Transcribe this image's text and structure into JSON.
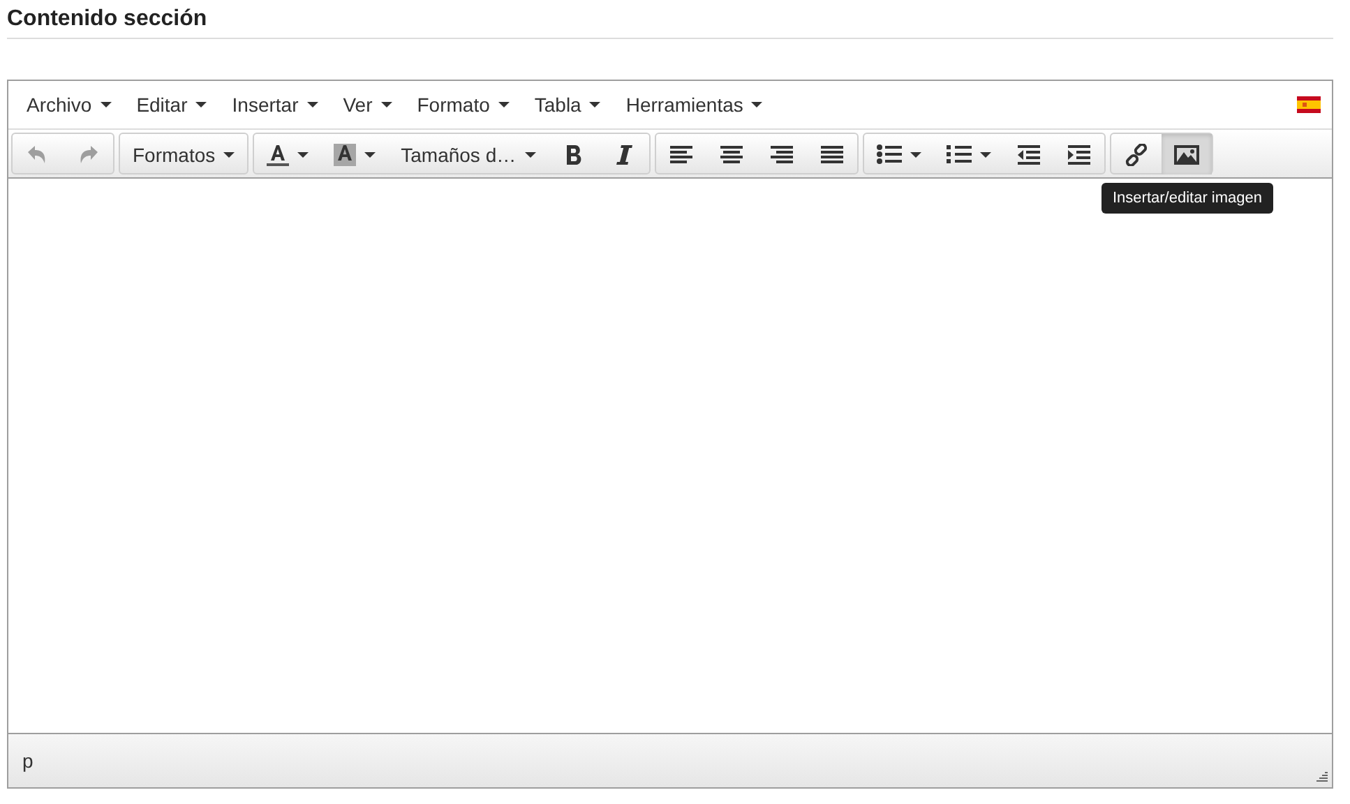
{
  "heading": "Contenido sección",
  "menu": [
    {
      "label": "Archivo"
    },
    {
      "label": "Editar"
    },
    {
      "label": "Insertar"
    },
    {
      "label": "Ver"
    },
    {
      "label": "Formato"
    },
    {
      "label": "Tabla"
    },
    {
      "label": "Herramientas"
    }
  ],
  "toolbar": [
    [
      {
        "kind": "undo",
        "disabled": true,
        "active": false
      },
      {
        "kind": "redo",
        "disabled": true,
        "active": false
      }
    ],
    [
      {
        "kind": "text",
        "label": "Formatos",
        "caret": true,
        "active": false
      }
    ],
    [
      {
        "kind": "forecolor",
        "caret": true,
        "active": false
      },
      {
        "kind": "backcolor",
        "caret": true,
        "active": false
      },
      {
        "kind": "text",
        "label": "Tamaños d…",
        "caret": true,
        "active": false
      },
      {
        "kind": "bold",
        "active": false
      },
      {
        "kind": "italic",
        "active": false
      }
    ],
    [
      {
        "kind": "alignleft",
        "active": false
      },
      {
        "kind": "aligncenter",
        "active": false
      },
      {
        "kind": "alignright",
        "active": false
      },
      {
        "kind": "alignjustify",
        "active": false
      }
    ],
    [
      {
        "kind": "bullist",
        "caret": true,
        "active": false
      },
      {
        "kind": "numlist",
        "caret": true,
        "active": false
      },
      {
        "kind": "outdent",
        "active": false
      },
      {
        "kind": "indent",
        "active": false
      }
    ],
    [
      {
        "kind": "link",
        "active": false
      },
      {
        "kind": "image",
        "active": true
      }
    ]
  ],
  "tooltip": "Insertar/editar imagen",
  "status_path": "p"
}
